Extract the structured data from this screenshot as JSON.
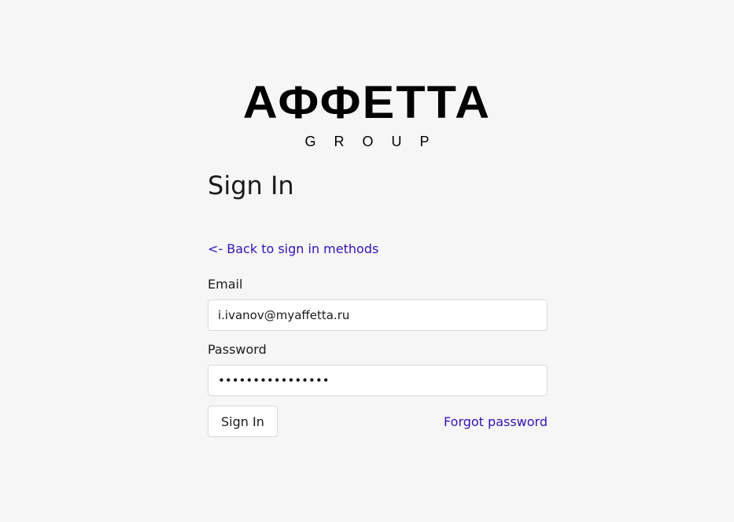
{
  "logo": {
    "main": "АФФЕТТА",
    "sub": "GROUP"
  },
  "form": {
    "title": "Sign In",
    "back_link": "<- Back to sign in methods",
    "email_label": "Email",
    "email_value": "i.ivanov@myaffetta.ru",
    "password_label": "Password",
    "password_value": "••••••••••••••••",
    "submit_label": "Sign In",
    "forgot_label": "Forgot password"
  },
  "colors": {
    "background": "#f6f6f6",
    "link": "#3511b8",
    "text": "#1a1a1a",
    "border": "#d8d8d8"
  }
}
